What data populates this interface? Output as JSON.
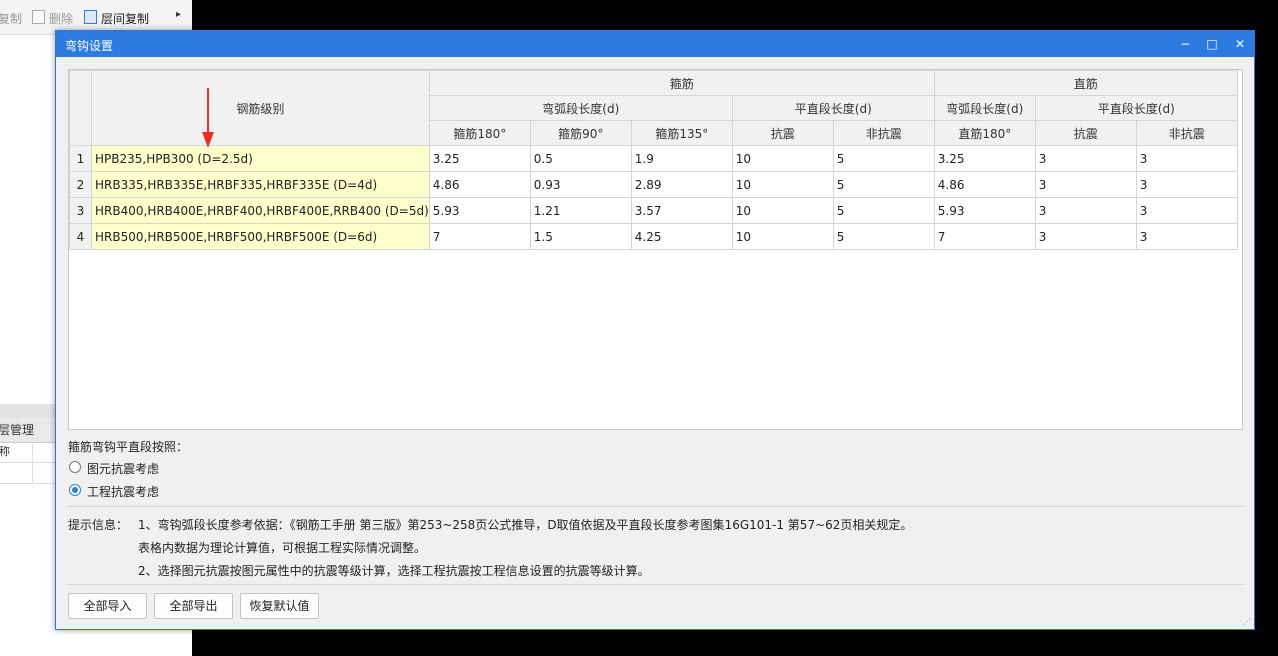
{
  "background": {
    "toolbar": {
      "copy": "复制",
      "delete": "删除",
      "floor_copy": "层间复制",
      "more": "▸"
    },
    "panel": {
      "header": "层管理",
      "col1": "称"
    }
  },
  "dialog": {
    "title": "弯钩设置",
    "controls": {
      "minimize": "−",
      "maximize": "□",
      "close": "✕"
    },
    "grid": {
      "header_grade": "钢筋级别",
      "header_stirrup": "箍筋",
      "header_straight": "直筋",
      "sub_arc": "弯弧段长度(d)",
      "sub_straight": "平直段长度(d)",
      "sub_arc_straight": "弯弧段长度(d)",
      "sub_straight_straight": "平直段长度(d)",
      "col_s180": "箍筋180°",
      "col_s90": "箍筋90°",
      "col_s135": "箍筋135°",
      "col_seismic": "抗震",
      "col_nonseismic": "非抗震",
      "col_z180": "直筋180°",
      "col_z_seismic": "抗震",
      "col_z_nonseismic": "非抗震",
      "rows": [
        {
          "num": "1",
          "grade": "HPB235,HPB300 (D=2.5d)",
          "values": [
            "3.25",
            "0.5",
            "1.9",
            "10",
            "5",
            "3.25",
            "3",
            "3"
          ]
        },
        {
          "num": "2",
          "grade": "HRB335,HRB335E,HRBF335,HRBF335E (D=4d)",
          "values": [
            "4.86",
            "0.93",
            "2.89",
            "10",
            "5",
            "4.86",
            "3",
            "3"
          ]
        },
        {
          "num": "3",
          "grade": "HRB400,HRB400E,HRBF400,HRBF400E,RRB400 (D=5d)",
          "values": [
            "5.93",
            "1.21",
            "3.57",
            "10",
            "5",
            "5.93",
            "3",
            "3"
          ]
        },
        {
          "num": "4",
          "grade": "HRB500,HRB500E,HRBF500,HRBF500E (D=6d)",
          "values": [
            "7",
            "1.5",
            "4.25",
            "10",
            "5",
            "7",
            "3",
            "3"
          ]
        }
      ]
    },
    "option_label": "箍筋弯钩平直段按照：",
    "options": [
      {
        "label": "图元抗震考虑",
        "checked": false
      },
      {
        "label": "工程抗震考虑",
        "checked": true
      }
    ],
    "tips": {
      "label": "提示信息：",
      "line1": "1、弯钩弧段长度参考依据：《钢筋工手册 第三版》第253~258页公式推导，D取值依据及平直段长度参考图集16G101-1 第57~62页相关规定。",
      "line2": "表格内数据为理论计算值，可根据工程实际情况调整。",
      "line3": "2、选择图元抗震按图元属性中的抗震等级计算，选择工程抗震按工程信息设置的抗震等级计算。"
    },
    "buttons": {
      "import_all": "全部导入",
      "export_all": "全部导出",
      "restore_default": "恢复默认值"
    },
    "colors": {
      "titlebar": "#2b7be1",
      "grade_cell": "#ffffcc",
      "arrow": "#e8322b"
    }
  }
}
